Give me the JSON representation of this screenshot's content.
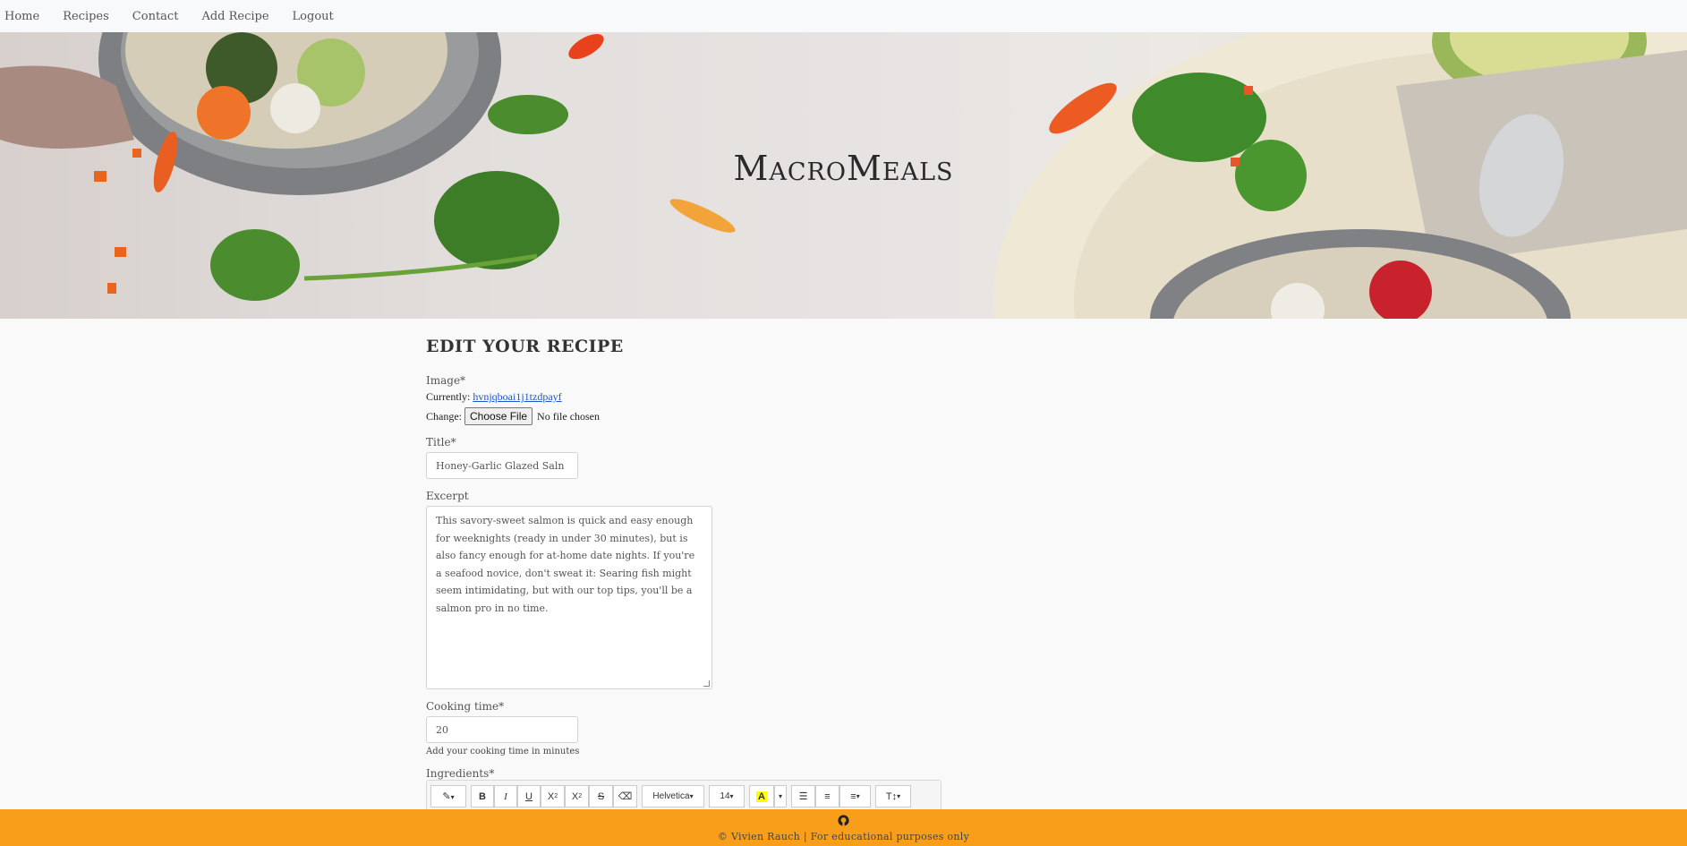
{
  "nav": {
    "items": [
      "Home",
      "Recipes",
      "Contact",
      "Add Recipe",
      "Logout"
    ]
  },
  "hero": {
    "title": "MacroMeals"
  },
  "form": {
    "heading": "EDIT YOUR RECIPE",
    "image": {
      "label": "Image*",
      "currently_label": "Currently:",
      "currently_value": "hvnjqboai1j1tzdpayf",
      "change_label": "Change:",
      "choose_button": "Choose File",
      "no_file": "No file chosen"
    },
    "title": {
      "label": "Title*",
      "value": "Honey-Garlic Glazed Saln"
    },
    "excerpt": {
      "label": "Excerpt",
      "value": "This savory-sweet salmon is quick and easy enough for weeknights (ready in under 30 minutes), but is also fancy enough for at-home date nights. If you're a seafood novice, don't sweat it: Searing fish might seem intimidating, but with our top tips, you'll be a salmon pro in no time."
    },
    "cooking_time": {
      "label": "Cooking time*",
      "value": "20",
      "help": "Add your cooking time in minutes"
    },
    "ingredients": {
      "label": "Ingredients*",
      "toolbar": {
        "bold": "B",
        "italic": "I",
        "underline": "U",
        "superscript": "X",
        "subscript": "X",
        "strikethrough": "S",
        "font_name": "Helvetica",
        "font_size": "14"
      }
    }
  },
  "footer": {
    "text": "© Vivien Rauch | For educational purposes only"
  },
  "colors": {
    "footer_bg": "#f89e1b",
    "link": "#1a57c8",
    "highlight": "#ffff00"
  }
}
